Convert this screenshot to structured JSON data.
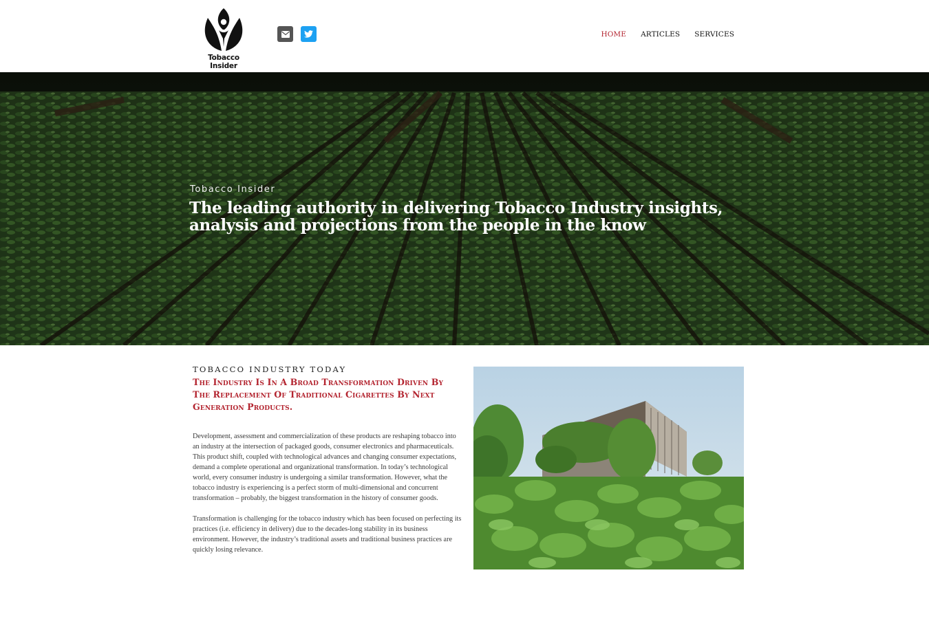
{
  "header": {
    "logo_text": "Tobacco Insider",
    "social": {
      "email_icon": "envelope-icon",
      "twitter_icon": "twitter-icon"
    },
    "nav": [
      {
        "label": "HOME",
        "active": true
      },
      {
        "label": "ARTICLES",
        "active": false
      },
      {
        "label": "SERVICES",
        "active": false
      }
    ]
  },
  "hero": {
    "kicker": "Tobacco Insider",
    "title": "The leading authority in delivering Tobacco Industry insights, analysis and projections from the people in the know"
  },
  "section": {
    "kicker": "Tobacco Industry Today",
    "heading": "The Industry Is In A Broad Transformation Driven By The Replacement Of Traditional Cigarettes By Next Generation Products.",
    "paragraphs": [
      "Development, assessment and commercialization of these products are reshaping tobacco into an industry at the intersection of packaged goods, consumer electronics and pharmaceuticals. This product shift, coupled with technological advances and changing consumer expectations, demand a complete operational and organizational transformation. In today’s technological world, every consumer industry is undergoing a similar transformation. However, what the tobacco industry is experiencing is a perfect storm of multi-dimensional and concurrent transformation – probably, the biggest transformation in the history of consumer goods.",
      "Transformation is challenging for the tobacco industry which has been focused on perfecting its practices (i.e. efficiency in delivery) due to the decades-long stability in its business environment. However, the industry’s traditional assets and traditional business practices are quickly losing relevance."
    ]
  },
  "colors": {
    "accent": "#b3242f",
    "twitter": "#1da1f2",
    "email": "#555555"
  }
}
